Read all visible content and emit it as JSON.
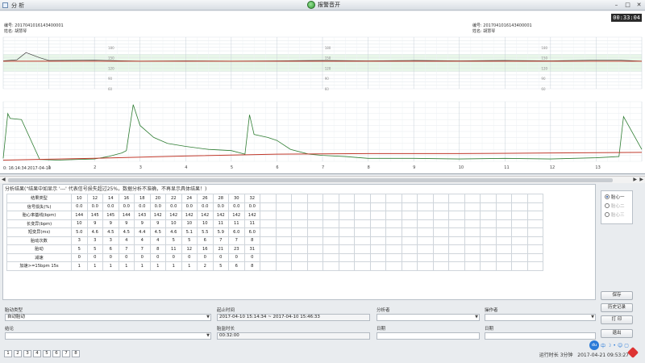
{
  "window": {
    "title": "分 析",
    "alarm_label": "报警音开",
    "timer": "00:33:04"
  },
  "chart_header": {
    "left_id": "编号: 2017041016143400001",
    "left_name": "姓名: 胡慧琴",
    "right_id": "编号: 2017041016143400001",
    "right_name": "姓名: 胡慧琴",
    "start_time": "0: 16:14:34",
    "start_date": "2017-04-10"
  },
  "chart_data": [
    {
      "type": "line",
      "ylim": [
        60,
        210
      ],
      "yticks_left": [
        180,
        150,
        120,
        90,
        60
      ],
      "normal_band": [
        110,
        160
      ],
      "series": [
        {
          "color": "#444444",
          "x": [
            0,
            0.3,
            0.5,
            0.8,
            1,
            2,
            3,
            4,
            5,
            6,
            7,
            8,
            9,
            10,
            11,
            12,
            13,
            13.5,
            14
          ],
          "values": [
            141,
            144,
            165,
            150,
            142,
            143,
            140,
            141,
            140,
            141,
            142,
            141,
            142,
            141,
            142,
            141,
            143,
            143,
            140
          ]
        },
        {
          "color": "#c0392b",
          "x": [
            0,
            14
          ],
          "values": [
            140,
            140
          ]
        }
      ]
    },
    {
      "type": "line",
      "ylim": [
        0,
        100
      ],
      "xticks": [
        "1",
        "2",
        "3",
        "4",
        "5",
        "6",
        "7",
        "8",
        "9",
        "10",
        "11",
        "12",
        "13"
      ],
      "series": [
        {
          "color": "#2e7d32",
          "x": [
            0,
            0.1,
            0.15,
            0.4,
            0.8,
            1.2,
            1.6,
            2.0,
            2.3,
            2.6,
            2.7,
            2.85,
            3.0,
            3.3,
            3.6,
            4.0,
            4.5,
            5.0,
            5.3,
            5.4,
            5.5,
            5.8,
            6.0,
            6.3,
            6.7,
            7.0,
            7.5,
            8.0,
            9.0,
            10.0,
            11.0,
            12.0,
            13.0,
            13.5,
            13.6,
            14.0
          ],
          "values": [
            5,
            80,
            72,
            70,
            3,
            2,
            3,
            4,
            8,
            14,
            18,
            95,
            60,
            40,
            30,
            25,
            20,
            18,
            12,
            78,
            45,
            40,
            35,
            20,
            12,
            10,
            8,
            5,
            5,
            4,
            5,
            4,
            6,
            8,
            75,
            20
          ]
        },
        {
          "color": "#c0392b",
          "x": [
            0,
            2,
            4,
            6,
            8,
            10,
            12,
            14
          ],
          "values": [
            2,
            5,
            9,
            12,
            13,
            13,
            14,
            15
          ]
        }
      ]
    }
  ],
  "results": {
    "note": "分析结果(\"结果中如显示 '---' 代表信号损失超过25%，数据分析不准确，不再显示具体结果！)",
    "rows": [
      {
        "label": "结果类型",
        "values": [
          "10",
          "12",
          "14",
          "16",
          "18",
          "20",
          "22",
          "24",
          "26",
          "28",
          "30",
          "32"
        ]
      },
      {
        "label": "信号损失(%)",
        "values": [
          "0.0",
          "0.0",
          "0.0",
          "0.0",
          "0.0",
          "0.0",
          "0.0",
          "0.0",
          "0.0",
          "0.0",
          "0.0",
          "0.0"
        ]
      },
      {
        "label": "胎心率基线(bpm)",
        "values": [
          "144",
          "145",
          "145",
          "144",
          "143",
          "142",
          "142",
          "142",
          "142",
          "142",
          "142",
          "142"
        ]
      },
      {
        "label": "长变异(bpm)",
        "values": [
          "10",
          "9",
          "9",
          "9",
          "9",
          "9",
          "10",
          "10",
          "10",
          "11",
          "11",
          "11"
        ]
      },
      {
        "label": "短变异(ms)",
        "values": [
          "5.0",
          "4.6",
          "4.5",
          "4.5",
          "4.4",
          "4.5",
          "4.6",
          "5.1",
          "5.5",
          "5.9",
          "6.0",
          "6.0"
        ]
      },
      {
        "label": "胎动次数",
        "values": [
          "3",
          "3",
          "3",
          "4",
          "4",
          "4",
          "5",
          "5",
          "6",
          "7",
          "7",
          "8"
        ]
      },
      {
        "label": "胎动",
        "values": [
          "5",
          "5",
          "6",
          "7",
          "7",
          "8",
          "11",
          "12",
          "16",
          "21",
          "23",
          "31"
        ]
      },
      {
        "label": "减速",
        "values": [
          "0",
          "0",
          "0",
          "0",
          "0",
          "0",
          "0",
          "0",
          "0",
          "0",
          "0",
          "0"
        ]
      },
      {
        "label": "加速>=15bpm 15s",
        "values": [
          "1",
          "1",
          "1",
          "1",
          "1",
          "1",
          "1",
          "1",
          "2",
          "5",
          "6",
          "8"
        ]
      }
    ]
  },
  "radio_options": [
    {
      "label": "胎心一",
      "selected": true,
      "enabled": true
    },
    {
      "label": "胎心二",
      "selected": false,
      "enabled": false
    },
    {
      "label": "胎心三",
      "selected": false,
      "enabled": false
    }
  ],
  "form": {
    "fm_type_label": "胎动类型",
    "fm_type_value": "自动胎动",
    "time_range_label": "起止时间",
    "time_range_value": "2017-04-10 15:14:34 ~ 2017-04-10 15:46:33",
    "analyst_label": "分析者",
    "operator_label": "操作者",
    "conclusion_label": "结论",
    "duration_label": "胎监时长",
    "duration_value": "00:32:00",
    "date1_label": "日期",
    "date2_label": "日期"
  },
  "buttons": {
    "save": "保存",
    "history": "历史记录",
    "print": "打 印",
    "exit": "退出"
  },
  "pager": [
    "1",
    "2",
    "3",
    "4",
    "5",
    "6",
    "7",
    "8"
  ],
  "status": {
    "runtime": "运行时长 3分钟",
    "datetime": "2017-04-21 09:53:27"
  },
  "float_toolbar": {
    "logo": "du",
    "lang": "中",
    "icons": [
      "moon-icon",
      "dot-icon",
      "smile-icon",
      "shirt-icon"
    ]
  }
}
